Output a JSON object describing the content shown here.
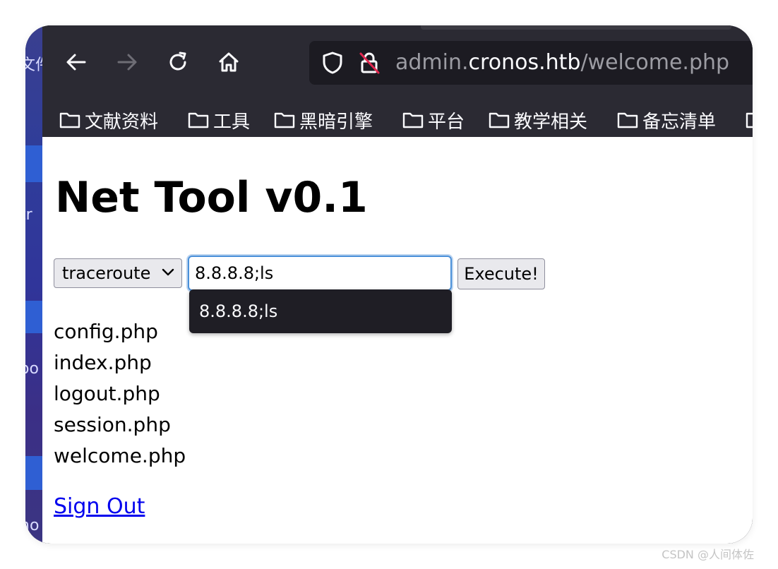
{
  "desktop": {
    "fragments": [
      "文件",
      "tr",
      "oo",
      "no"
    ]
  },
  "browser": {
    "nav": {
      "back_icon": "arrow-left",
      "forward_icon": "arrow-right",
      "reload_icon": "reload",
      "home_icon": "home"
    },
    "url": {
      "prefix": "admin.",
      "host": "cronos.htb",
      "path": "/welcome.php"
    },
    "bookmarks": [
      "文献资料",
      "工具",
      "黑暗引擎",
      "平台",
      "教学相关",
      "备忘清单"
    ]
  },
  "page": {
    "title": "Net Tool v0.1",
    "form": {
      "command_selected": "traceroute",
      "host_value": "8.8.8.8;ls",
      "execute_label": "Execute!",
      "autocomplete_suggestion": "8.8.8.8;ls"
    },
    "output_files": [
      "config.php",
      "index.php",
      "logout.php",
      "session.php",
      "welcome.php"
    ],
    "sign_out_label": "Sign Out"
  },
  "watermark": "CSDN @人间体佐"
}
